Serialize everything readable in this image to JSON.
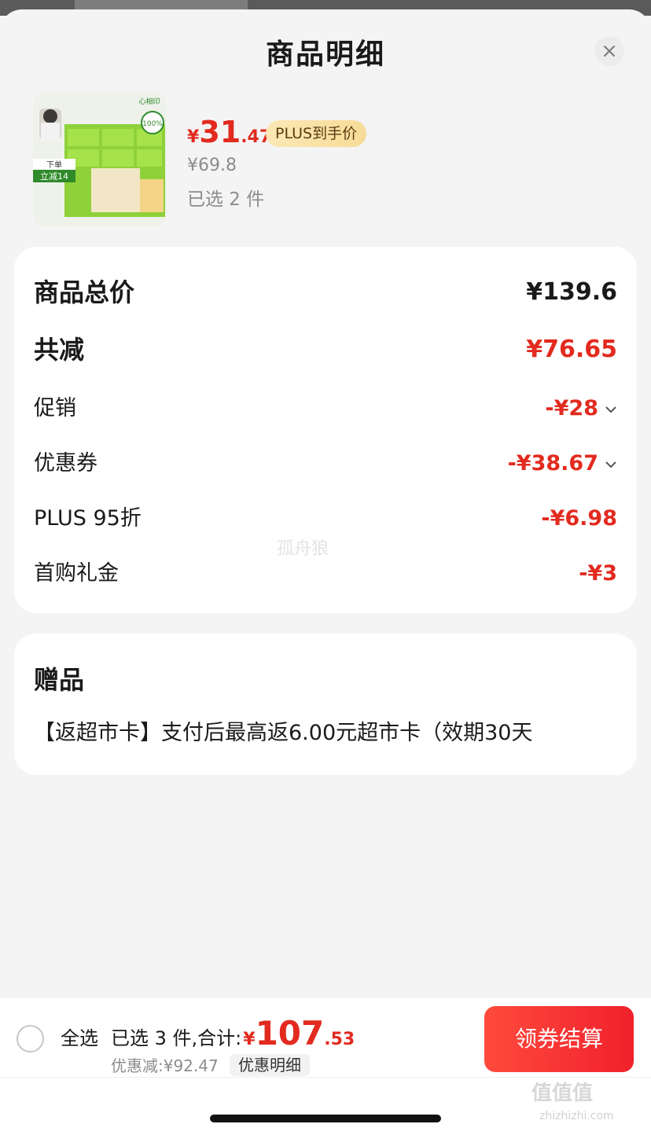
{
  "sheet": {
    "title": "商品明细"
  },
  "product": {
    "price_currency": "¥",
    "price_integer": "31",
    "price_decimal": ".47",
    "plus_badge": "PLUS到手价",
    "original_price": "¥69.8",
    "selected_count": "已选 2 件",
    "image_text": {
      "brand": "心相印",
      "badge": "100%",
      "tag_top": "下单",
      "tag_bottom": "立减14"
    }
  },
  "summary_card": {
    "total_label": "商品总价",
    "total_value": "¥139.6",
    "reduction_label": "共减",
    "reduction_value": "¥76.65",
    "items": [
      {
        "label": "促销",
        "value": "-¥28",
        "expandable": true
      },
      {
        "label": "优惠券",
        "value": "-¥38.67",
        "expandable": true
      },
      {
        "label": "PLUS 95折",
        "value": "-¥6.98",
        "expandable": false
      },
      {
        "label": "首购礼金",
        "value": "-¥3",
        "expandable": false
      }
    ],
    "watermark": "孤舟狼"
  },
  "gift_card": {
    "title": "赠品",
    "text": "【返超市卡】支付后最高返6.00元超市卡（效期30天"
  },
  "bottom_bar": {
    "select_all": "全选",
    "summary_text": "已选 3 件,合计:",
    "total_currency": "¥",
    "total_integer": "107",
    "total_decimal": ".53",
    "saved_text": "优惠减:¥92.47",
    "detail_link": "优惠明细",
    "checkout_label": "领券结算"
  },
  "corner_watermark": {
    "logo": "值值值",
    "url": "zhizhizhi.com"
  },
  "colors": {
    "accent_red": "#e22a1f",
    "checkout_gradient": [
      "#ff4a3d",
      "#f0212b"
    ],
    "plus_gold": "#f7dc98"
  }
}
